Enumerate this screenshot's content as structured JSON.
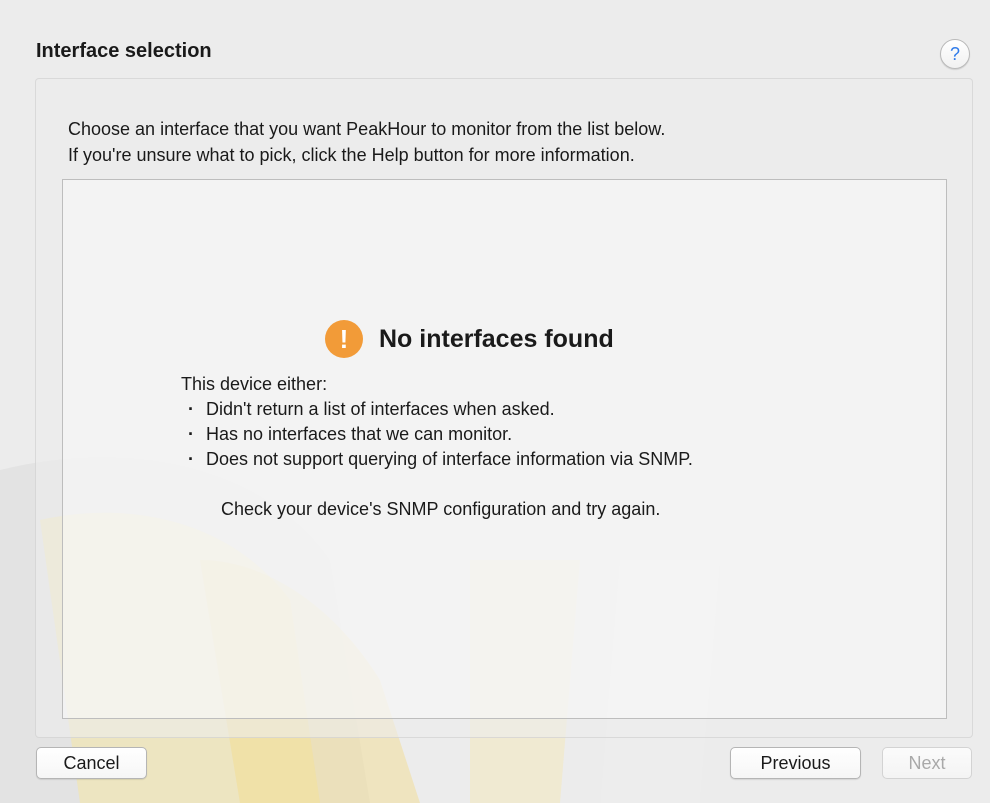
{
  "header": {
    "title": "Interface selection",
    "help_label": "?"
  },
  "instructions": {
    "line1": "Choose an interface that you want PeakHour to monitor from the list below.",
    "line2": "If you're unsure what to pick, click the Help button for more information."
  },
  "empty_state": {
    "icon_glyph": "!",
    "title": "No interfaces found",
    "lead": "This device either:",
    "reasons": [
      "Didn't return a list of interfaces when asked.",
      "Has no interfaces that we can monitor.",
      "Does not support querying of interface information via SNMP."
    ],
    "advice": "Check your device's SNMP configuration and try again."
  },
  "buttons": {
    "cancel": "Cancel",
    "previous": "Previous",
    "next": "Next"
  },
  "colors": {
    "warning": "#f29b38",
    "help_accent": "#2f7bea",
    "disabled_text": "#a9a9a9"
  }
}
